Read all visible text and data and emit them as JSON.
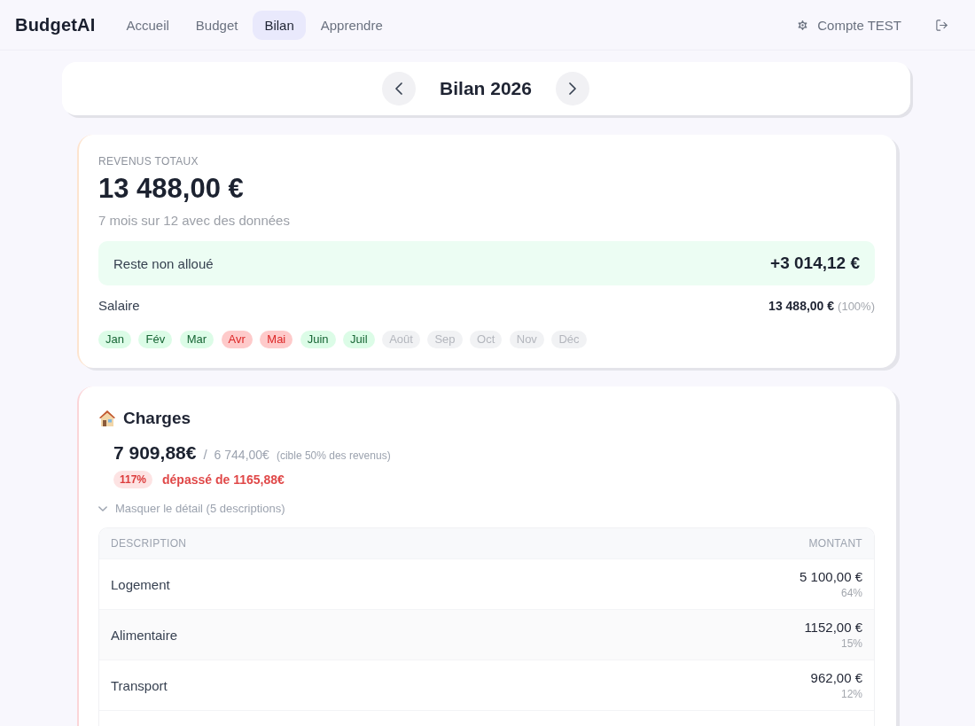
{
  "header": {
    "logo": "BudgetAI",
    "nav": [
      {
        "label": "Accueil",
        "selected": false
      },
      {
        "label": "Budget",
        "selected": false
      },
      {
        "label": "Bilan",
        "selected": true
      },
      {
        "label": "Apprendre",
        "selected": false
      }
    ],
    "account": "Compte TEST"
  },
  "year_nav": {
    "title": "Bilan 2026"
  },
  "revenue": {
    "label": "REVENUS TOTAUX",
    "total": "13 488,00 €",
    "subtitle": "7 mois sur 12 avec des données",
    "unallocated": {
      "label": "Reste non alloué",
      "amount": "+3 014,12 €"
    },
    "sources": [
      {
        "name": "Salaire",
        "amount": "13 488,00 €",
        "share": "(100%)",
        "months": [
          {
            "label": "Jan",
            "color": "#dcfce7"
          },
          {
            "label": "Fév",
            "color": "#dcfce7"
          },
          {
            "label": "Mar",
            "color": "#dcfce7"
          },
          {
            "label": "Avr",
            "color": "#fecaca"
          },
          {
            "label": "Mai",
            "color": "#fecaca"
          },
          {
            "label": "Juin",
            "color": "#dcfce7"
          },
          {
            "label": "Juil",
            "color": "#dcfce7"
          },
          {
            "label": "Août",
            "color": "#f1f2f4"
          },
          {
            "label": "Sep",
            "color": "#f1f2f4"
          },
          {
            "label": "Oct",
            "color": "#f1f2f4"
          },
          {
            "label": "Nov",
            "color": "#f1f2f4"
          },
          {
            "label": "Déc",
            "color": "#f1f2f4"
          }
        ]
      }
    ]
  },
  "charges": {
    "title": "Charges",
    "amount": "7 909,88€",
    "separator": "/",
    "target": "6 744,00€",
    "target_note": "(cible 50% des revenus)",
    "percent": "117%",
    "overrun": "dépassé de 1165,88€",
    "detail_toggle": {
      "label": "Masquer le détail (5 descriptions)",
      "expanded": true
    },
    "table": {
      "columns": [
        "DESCRIPTION",
        "MONTANT"
      ],
      "rows": [
        {
          "description": "Logement",
          "amount": "5 100,00 €",
          "share": "64%"
        },
        {
          "description": "Alimentaire",
          "amount": "1152,00 €",
          "share": "15%"
        },
        {
          "description": "Transport",
          "amount": "962,00 €",
          "share": "12%"
        }
      ]
    }
  }
}
